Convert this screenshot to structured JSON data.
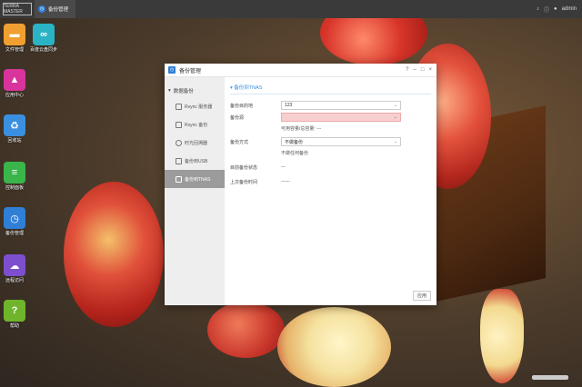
{
  "topbar": {
    "logo": "TERRA MASTER",
    "active_task": "备份管理",
    "user": "admin",
    "icons": [
      "bell-icon",
      "info-icon",
      "user-icon"
    ]
  },
  "desktop": {
    "icons": [
      {
        "label": "文件管理",
        "color": "#f0a030",
        "glyph": "▬"
      },
      {
        "label": "百度云盘同步",
        "color": "#2ab3c4",
        "glyph": "∞"
      },
      {
        "label": "应用中心",
        "color": "#d8349c",
        "glyph": "▲"
      },
      {
        "label": "回收站",
        "color": "#3a8fe0",
        "glyph": "♻"
      },
      {
        "label": "控制面板",
        "color": "#39b54a",
        "glyph": "≡"
      },
      {
        "label": "备份管理",
        "color": "#2f7fd6",
        "glyph": "◷"
      },
      {
        "label": "远程访问",
        "color": "#7d4fcf",
        "glyph": "☁"
      },
      {
        "label": "帮助",
        "color": "#6fb52c",
        "glyph": "?"
      }
    ]
  },
  "window": {
    "title": "备份管理",
    "controls": {
      "help": "?",
      "minimize": "–",
      "maximize": "□",
      "close": "×"
    },
    "nav": {
      "header": "数据备份",
      "items": [
        {
          "label": "Rsync 服务器"
        },
        {
          "label": "Rsync 备份"
        },
        {
          "label": "时光回溯器"
        },
        {
          "label": "备份到USB"
        },
        {
          "label": "备份到TNAS"
        }
      ]
    },
    "section_title": "备份到TNAS",
    "form": {
      "target_label": "备份目的地",
      "target_value": "123",
      "source_label": "备份源",
      "source_value": "",
      "available_note": "可用容量/总容量: ---",
      "mode_label": "备份方式",
      "mode_value": "不做备份",
      "mode_note": "不做任何备份",
      "status_label": "目前备份状态",
      "status_value": "---",
      "last_time_label": "上次备份时间",
      "last_time_value": "------"
    },
    "apply_label": "应用"
  }
}
